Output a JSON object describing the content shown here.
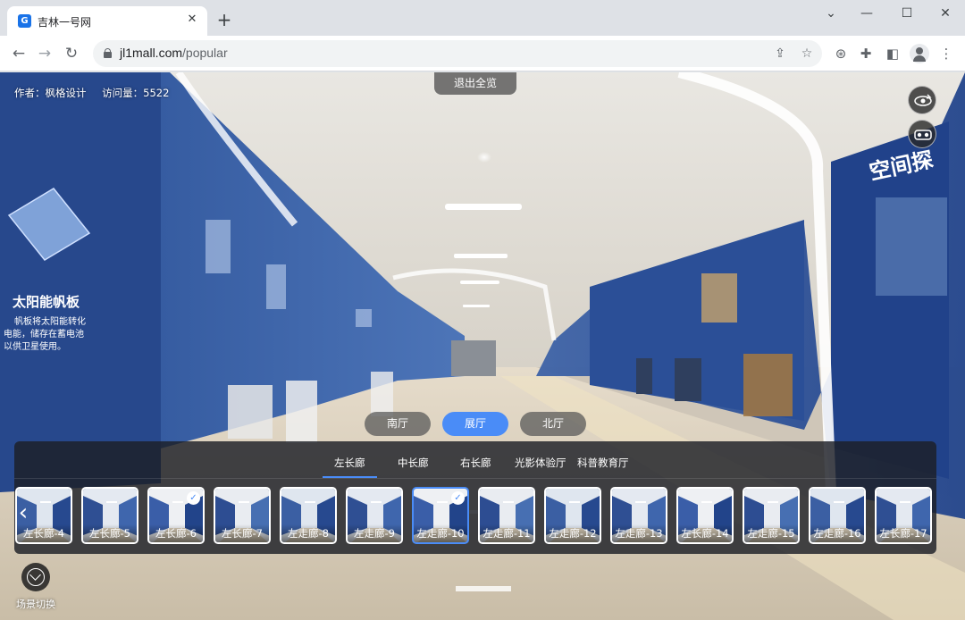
{
  "browser": {
    "tab_title": "吉林一号网",
    "favicon_letter": "G",
    "url_host": "jl1mall.com",
    "url_path": "/popular",
    "icons": [
      "back-icon",
      "forward-icon",
      "reload-icon",
      "lock-icon",
      "share-icon",
      "star-icon",
      "extension-puzzle-icon",
      "side-panel-icon",
      "profile-icon",
      "more-icon"
    ]
  },
  "viewer": {
    "author_label": "作者：枫格设计",
    "visits_label": "访问量：5522",
    "exit_button": "退出全览",
    "halls": [
      {
        "label": "南厅",
        "active": false
      },
      {
        "label": "展厅",
        "active": true
      },
      {
        "label": "北厅",
        "active": false
      }
    ],
    "subtabs": [
      "左长廊",
      "中长廊",
      "右长廊",
      "光影体验厅",
      "科普教育厅"
    ],
    "active_subtab": "左长廊",
    "thumbnails": [
      {
        "label": "左长廊-4",
        "checked": false,
        "selected": false
      },
      {
        "label": "左长廊-5",
        "checked": false,
        "selected": false
      },
      {
        "label": "左长廊-6",
        "checked": true,
        "selected": false
      },
      {
        "label": "左长廊-7",
        "checked": false,
        "selected": false
      },
      {
        "label": "左走廊-8",
        "checked": false,
        "selected": false
      },
      {
        "label": "左走廊-9",
        "checked": false,
        "selected": false
      },
      {
        "label": "左走廊-10",
        "checked": true,
        "selected": true
      },
      {
        "label": "左走廊-11",
        "checked": false,
        "selected": false
      },
      {
        "label": "左走廊-12",
        "checked": false,
        "selected": false
      },
      {
        "label": "左走廊-13",
        "checked": false,
        "selected": false
      },
      {
        "label": "左长廊-14",
        "checked": false,
        "selected": false
      },
      {
        "label": "左走廊-15",
        "checked": false,
        "selected": false
      },
      {
        "label": "左走廊-16",
        "checked": false,
        "selected": false
      },
      {
        "label": "左长廊-17",
        "checked": false,
        "selected": false
      }
    ],
    "scene_switch_label": "场景切换",
    "wall_text": {
      "solar_title": "太阳能帆板",
      "solar_desc_1": "帆板将太阳能转化",
      "solar_desc_2": "电能，储存在蓄电池",
      "solar_desc_3": "以供卫星使用。",
      "space_title": "空间探"
    }
  }
}
